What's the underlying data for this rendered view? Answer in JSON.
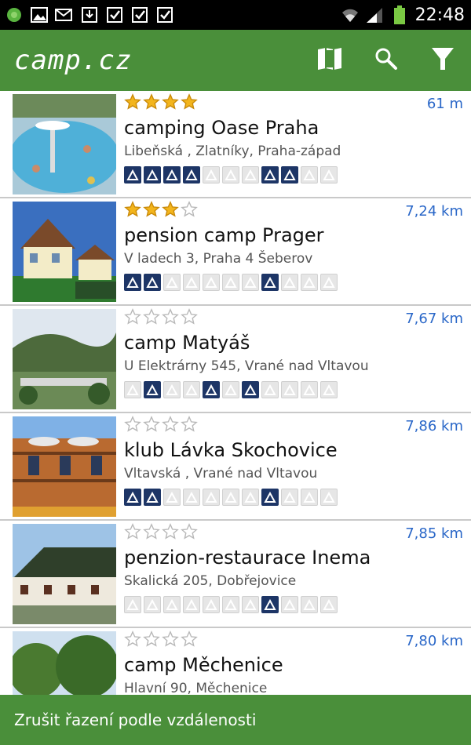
{
  "status_bar": {
    "time": "22:48"
  },
  "app": {
    "logo": "camp.cz",
    "colors": {
      "primary": "#4a8f3a",
      "accent": "#2a67c8",
      "amenity_on": "#1d3566"
    }
  },
  "actions": [
    "map-icon",
    "search-icon",
    "filter-icon"
  ],
  "items": [
    {
      "name": "camping Oase Praha",
      "address": "Libeňská , Zlatníky, Praha-západ",
      "distance": "61 m",
      "stars": 4,
      "amenities": [
        1,
        1,
        1,
        1,
        0,
        0,
        0,
        1,
        1,
        0,
        0
      ],
      "photo": "pool"
    },
    {
      "name": "pension camp Prager",
      "address": "V ladech 3, Praha 4 Šeberov",
      "distance": "7,24 km",
      "stars": 3,
      "amenities": [
        1,
        1,
        0,
        0,
        0,
        0,
        0,
        1,
        0,
        0,
        0
      ],
      "photo": "house"
    },
    {
      "name": "camp Matyáš",
      "address": "U Elektrárny 545, Vrané nad Vltavou",
      "distance": "7,67 km",
      "stars": 0,
      "amenities": [
        0,
        1,
        0,
        0,
        1,
        0,
        1,
        0,
        0,
        0,
        0
      ],
      "photo": "valley"
    },
    {
      "name": "klub Lávka Skochovice",
      "address": "Vltavská , Vrané nad Vltavou",
      "distance": "7,86 km",
      "stars": 0,
      "amenities": [
        1,
        1,
        0,
        0,
        0,
        0,
        0,
        1,
        0,
        0,
        0
      ],
      "photo": "balcony"
    },
    {
      "name": "penzion-restaurace Inema",
      "address": "Skalická 205, Dobřejovice",
      "distance": "7,85 km",
      "stars": 0,
      "amenities": [
        0,
        0,
        0,
        0,
        0,
        0,
        0,
        1,
        0,
        0,
        0
      ],
      "photo": "inn"
    },
    {
      "name": "camp Měchenice",
      "address": "Hlavní 90, Měchenice",
      "distance": "7,80 km",
      "stars": 0,
      "amenities": [],
      "photo": "trees"
    }
  ],
  "bottom_action": "Zrušit řazení podle vzdálenosti"
}
